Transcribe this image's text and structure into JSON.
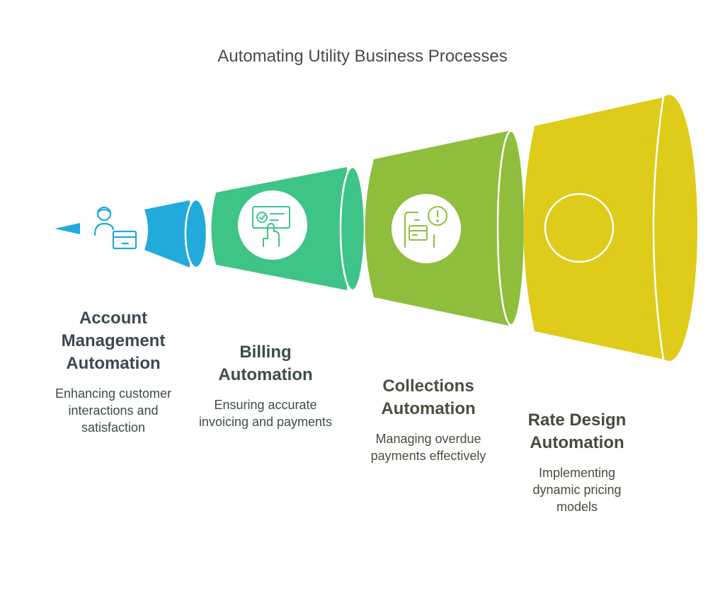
{
  "title": "Automating Utility Business Processes",
  "colors": {
    "blue": "#22aadb",
    "green": "#3ec486",
    "lime": "#8fbd3c",
    "yellow": "#dfcb1a",
    "white": "#ffffff"
  },
  "stages": [
    {
      "heading": "Account Management Automation",
      "description": "Enhancing customer interactions and satisfaction",
      "icon": "customer-card-icon",
      "color": "#22aadb"
    },
    {
      "heading": "Billing Automation",
      "description": "Ensuring accurate invoicing and payments",
      "icon": "invoice-approval-icon",
      "color": "#3ec486"
    },
    {
      "heading": "Collections Automation",
      "description": "Managing overdue payments effectively",
      "icon": "overdue-payment-icon",
      "color": "#8fbd3c"
    },
    {
      "heading": "Rate Design Automation",
      "description": "Implementing dynamic pricing models",
      "icon": "empty-circle-icon",
      "color": "#dfcb1a"
    }
  ]
}
